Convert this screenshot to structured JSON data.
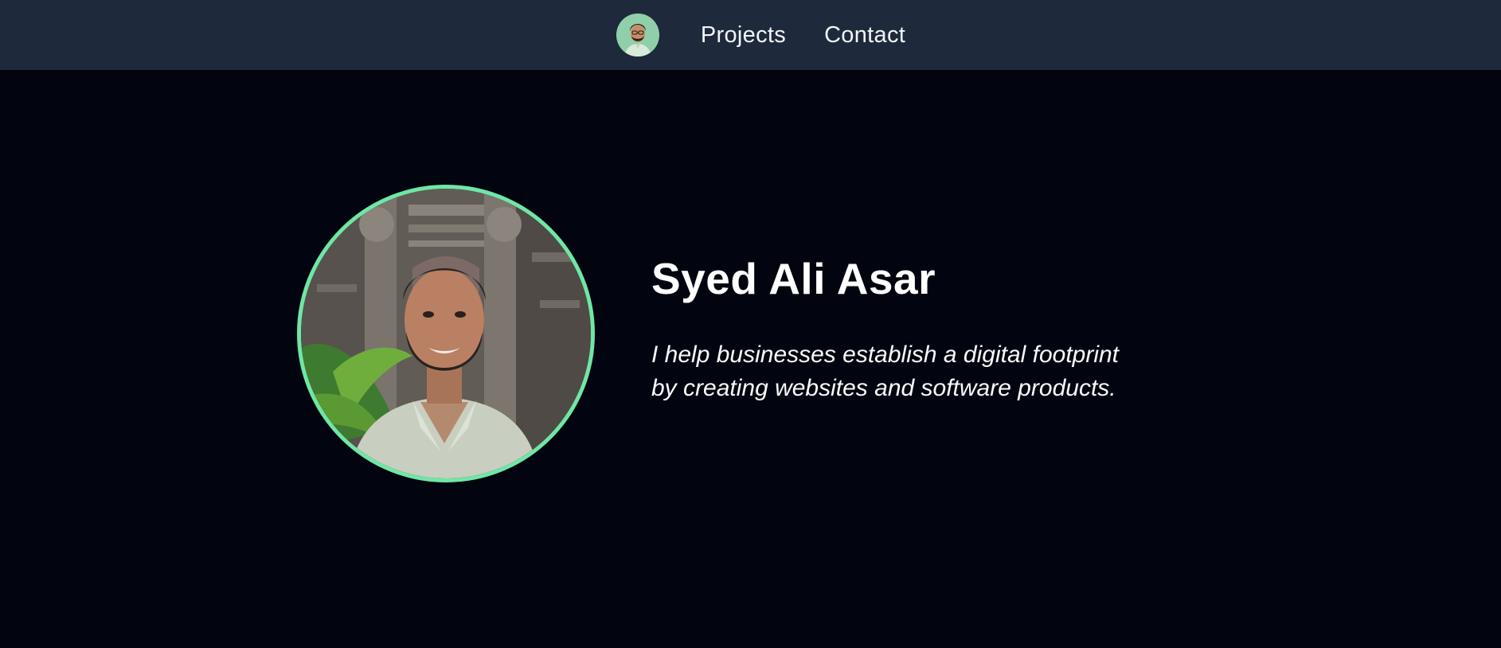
{
  "nav": {
    "avatar_icon": "cartoon-avatar-icon",
    "links": [
      {
        "label": "Projects"
      },
      {
        "label": "Contact"
      }
    ]
  },
  "hero": {
    "name": "Syed Ali Asar",
    "tagline_lines": [
      "I help businesses establish a digital footprint",
      "by creating websites and software products."
    ],
    "portrait_icon": "profile-photo"
  },
  "colors": {
    "page_background": "#02050f",
    "nav_background": "#1e293b",
    "accent_ring": "#6ee7a6",
    "text": "#ffffff"
  }
}
